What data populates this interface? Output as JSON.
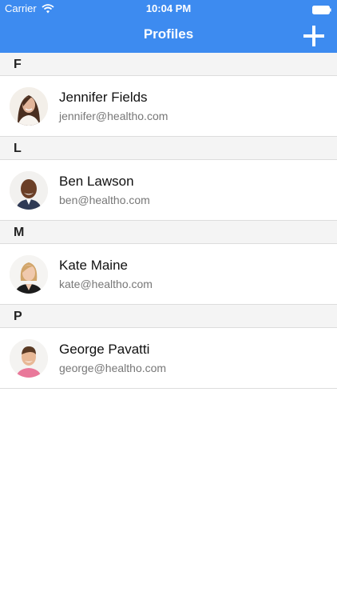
{
  "status_bar": {
    "carrier": "Carrier",
    "time": "10:04 PM",
    "wifi_icon": "wifi-icon",
    "battery_icon": "battery-icon"
  },
  "nav": {
    "title": "Profiles",
    "add_icon": "plus-icon"
  },
  "colors": {
    "accent": "#3d8bf0",
    "section_bg": "#f4f4f4"
  },
  "sections": [
    {
      "letter": "F",
      "profiles": [
        {
          "name": "Jennifer Fields",
          "email": "jennifer@healtho.com"
        }
      ]
    },
    {
      "letter": "L",
      "profiles": [
        {
          "name": "Ben Lawson",
          "email": "ben@healtho.com"
        }
      ]
    },
    {
      "letter": "M",
      "profiles": [
        {
          "name": "Kate Maine",
          "email": "kate@healtho.com"
        }
      ]
    },
    {
      "letter": "P",
      "profiles": [
        {
          "name": "George Pavatti",
          "email": "george@healtho.com"
        }
      ]
    }
  ]
}
